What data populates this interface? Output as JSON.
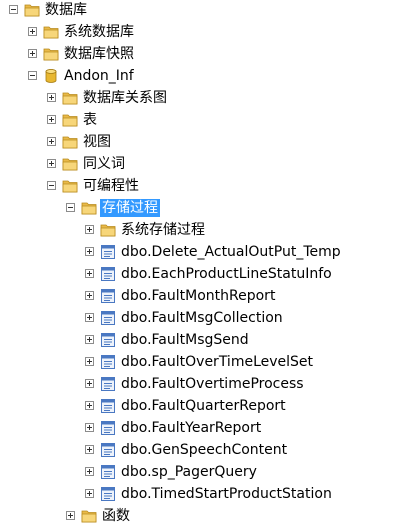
{
  "tree": {
    "root": {
      "label": "数据库",
      "icon": "folder-icon",
      "state": "expanded"
    },
    "root_children": [
      {
        "label": "系统数据库",
        "icon": "folder-icon",
        "state": "collapsed"
      },
      {
        "label": "数据库快照",
        "icon": "folder-icon",
        "state": "collapsed"
      },
      {
        "label": "Andon_Inf",
        "icon": "database-icon",
        "state": "expanded"
      }
    ],
    "database_children": [
      {
        "label": "数据库关系图",
        "icon": "folder-icon",
        "state": "collapsed"
      },
      {
        "label": "表",
        "icon": "folder-icon",
        "state": "collapsed"
      },
      {
        "label": "视图",
        "icon": "folder-icon",
        "state": "collapsed"
      },
      {
        "label": "同义词",
        "icon": "folder-icon",
        "state": "collapsed"
      },
      {
        "label": "可编程性",
        "icon": "folder-icon",
        "state": "expanded"
      }
    ],
    "programmability_children": [
      {
        "label": "存储过程",
        "icon": "folder-icon",
        "state": "expanded",
        "selected": true
      }
    ],
    "stored_procedures": [
      {
        "label": "系统存储过程",
        "icon": "folder-icon",
        "state": "collapsed"
      },
      {
        "label": "dbo.Delete_ActualOutPut_Temp",
        "icon": "stored-procedure-icon",
        "state": "collapsed"
      },
      {
        "label": "dbo.EachProductLineStatuInfo",
        "icon": "stored-procedure-icon",
        "state": "collapsed"
      },
      {
        "label": "dbo.FaultMonthReport",
        "icon": "stored-procedure-icon",
        "state": "collapsed"
      },
      {
        "label": "dbo.FaultMsgCollection",
        "icon": "stored-procedure-icon",
        "state": "collapsed"
      },
      {
        "label": "dbo.FaultMsgSend",
        "icon": "stored-procedure-icon",
        "state": "collapsed"
      },
      {
        "label": "dbo.FaultOverTimeLevelSet",
        "icon": "stored-procedure-icon",
        "state": "collapsed"
      },
      {
        "label": "dbo.FaultOvertimeProcess",
        "icon": "stored-procedure-icon",
        "state": "collapsed"
      },
      {
        "label": "dbo.FaultQuarterReport",
        "icon": "stored-procedure-icon",
        "state": "collapsed"
      },
      {
        "label": "dbo.FaultYearReport",
        "icon": "stored-procedure-icon",
        "state": "collapsed"
      },
      {
        "label": "dbo.GenSpeechContent",
        "icon": "stored-procedure-icon",
        "state": "collapsed"
      },
      {
        "label": "dbo.sp_PagerQuery",
        "icon": "stored-procedure-icon",
        "state": "collapsed"
      },
      {
        "label": "dbo.TimedStartProductStation",
        "icon": "stored-procedure-icon",
        "state": "collapsed"
      }
    ],
    "after_stored_procedures": [
      {
        "label": "函数",
        "icon": "folder-icon",
        "state": "collapsed"
      }
    ],
    "colors": {
      "selection": "#3399ff",
      "folder": "#f2c55c",
      "database": "#e8b730",
      "procedure": "#4a78c2"
    }
  }
}
